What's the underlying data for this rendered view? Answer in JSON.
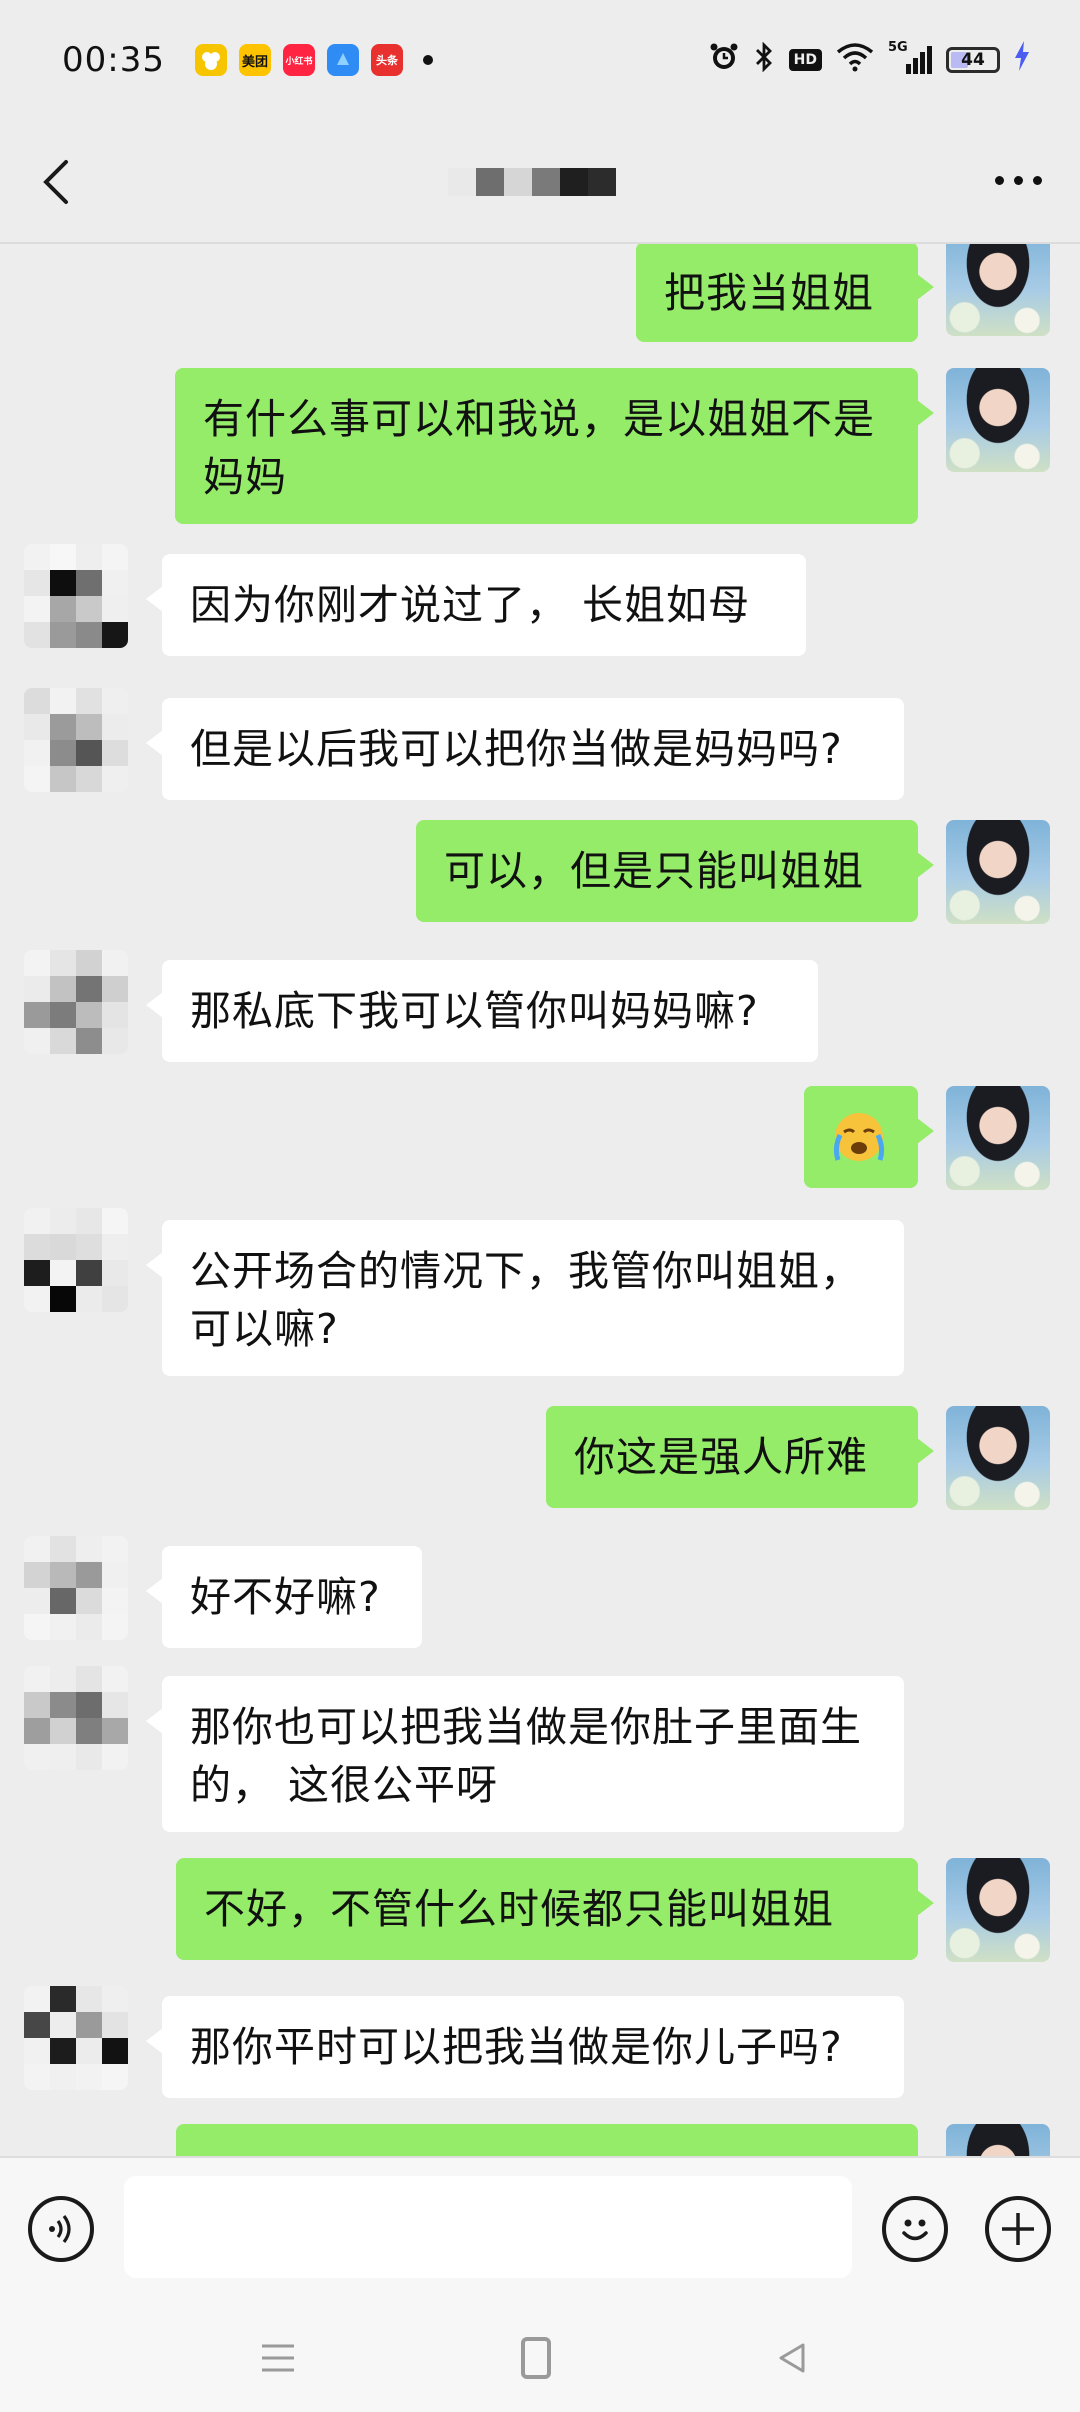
{
  "status_bar": {
    "time": "00:35",
    "app_icons": [
      {
        "name": "app-icon-1",
        "label": "",
        "color": "#f7c400"
      },
      {
        "name": "meituan-icon",
        "label": "美团",
        "color": "#ffc300"
      },
      {
        "name": "xiaohongshu-icon",
        "label": "小红书",
        "color": "#ff2442"
      },
      {
        "name": "app-icon-4",
        "label": "",
        "color": "#2f8cf4"
      },
      {
        "name": "toutiao-icon",
        "label": "头条",
        "color": "#e8312f"
      }
    ],
    "hd_label": "HD",
    "signal_label": "5G",
    "battery_level": "44",
    "battery_fraction": 0.44
  },
  "header": {
    "title_redacted": true
  },
  "messages": [
    {
      "from": "me",
      "text": "把我当姐姐"
    },
    {
      "from": "me",
      "text": "有什么事可以和我说，是以姐姐不是妈妈"
    },
    {
      "from": "other",
      "text": "因为你刚才说过了， 长姐如母"
    },
    {
      "from": "other",
      "text": "但是以后我可以把你当做是妈妈吗?"
    },
    {
      "from": "me",
      "text": "可以，但是只能叫姐姐"
    },
    {
      "from": "other",
      "text": "那私底下我可以管你叫妈妈嘛?"
    },
    {
      "from": "me",
      "text": "😭"
    },
    {
      "from": "other",
      "text": "公开场合的情况下，我管你叫姐姐，可以嘛?"
    },
    {
      "from": "me",
      "text": "你这是强人所难"
    },
    {
      "from": "other",
      "text": "好不好嘛?"
    },
    {
      "from": "other",
      "text": " 那你也可以把我当做是你肚子里面生的， 这很公平呀"
    },
    {
      "from": "me",
      "text": "不好，不管什么时候都只能叫姐姐"
    },
    {
      "from": "other",
      "text": "那你平时可以把我当做是你儿子吗?"
    }
  ],
  "input_bar": {
    "placeholder": "",
    "voice_icon": "voice-icon",
    "emoji_icon": "emoji-icon",
    "plus_icon": "plus-icon"
  },
  "nav": {
    "menu_icon": "menu-icon",
    "home_icon": "home-icon",
    "back_icon": "back-triangle-icon"
  },
  "colors": {
    "background": "#ededed",
    "my_bubble": "#95ec69",
    "other_bubble": "#ffffff"
  }
}
